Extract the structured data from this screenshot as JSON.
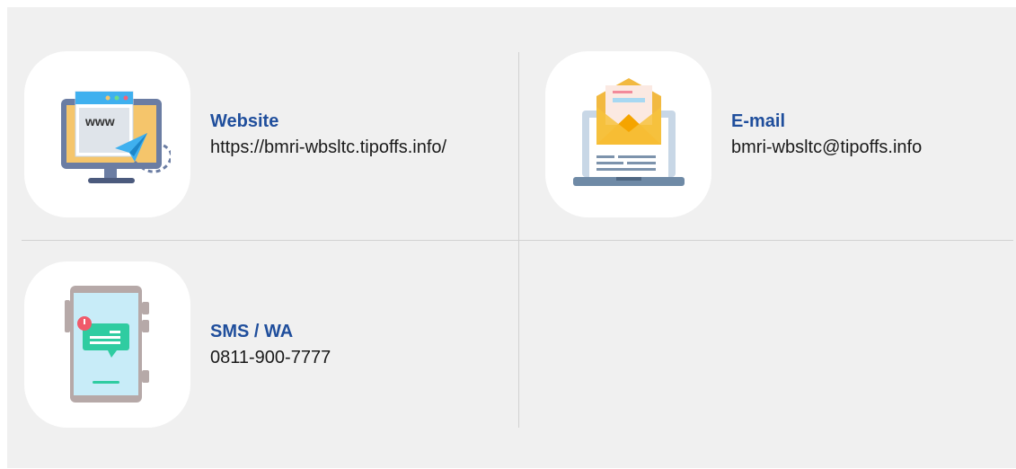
{
  "contacts": [
    {
      "label": "Website",
      "value": "https://bmri-wbsltc.tipoffs.info/",
      "icon": "website-monitor-icon",
      "icon_text": "www"
    },
    {
      "label": "E-mail",
      "value": "bmri-wbsltc@tipoffs.info",
      "icon": "email-laptop-icon"
    },
    {
      "label": "SMS / WA",
      "value": "0811-900-7777",
      "icon": "sms-phone-icon"
    }
  ],
  "colors": {
    "panel": "#f0f0f0",
    "label": "#1f4e9c",
    "divider": "#d2d2d2"
  }
}
